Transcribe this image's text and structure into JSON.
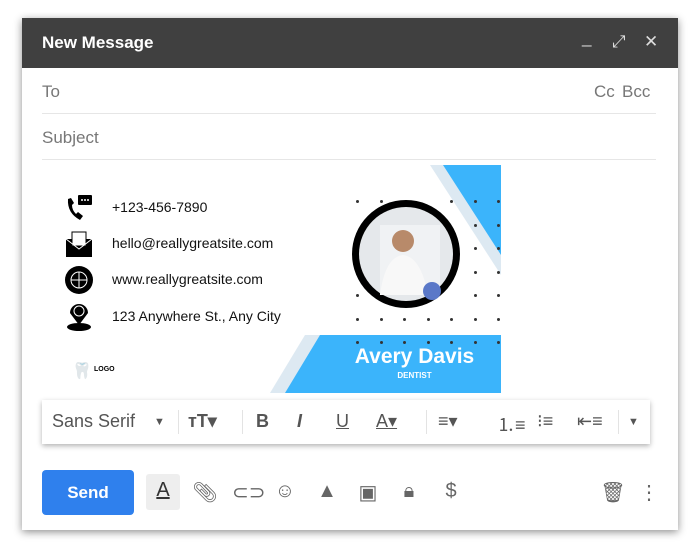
{
  "window": {
    "title": "New Message",
    "minimize_icon": "minimize-icon",
    "expand_icon": "expand-icon",
    "close_icon": "close-icon"
  },
  "to": {
    "label": "To",
    "cc": "Cc",
    "bcc": "Bcc"
  },
  "subject": {
    "placeholder": "Subject"
  },
  "signature": {
    "phone": "+123-456-7890",
    "email": "hello@reallygreatsite.com",
    "website": "www.reallygreatsite.com",
    "address": "123 Anywhere St., Any City",
    "logo": "LOGO",
    "name": "Avery Davis",
    "role": "DENTIST",
    "accent": "#3bb4fb"
  },
  "format": {
    "font": "Sans Serif"
  },
  "actions": {
    "send": "Send"
  }
}
